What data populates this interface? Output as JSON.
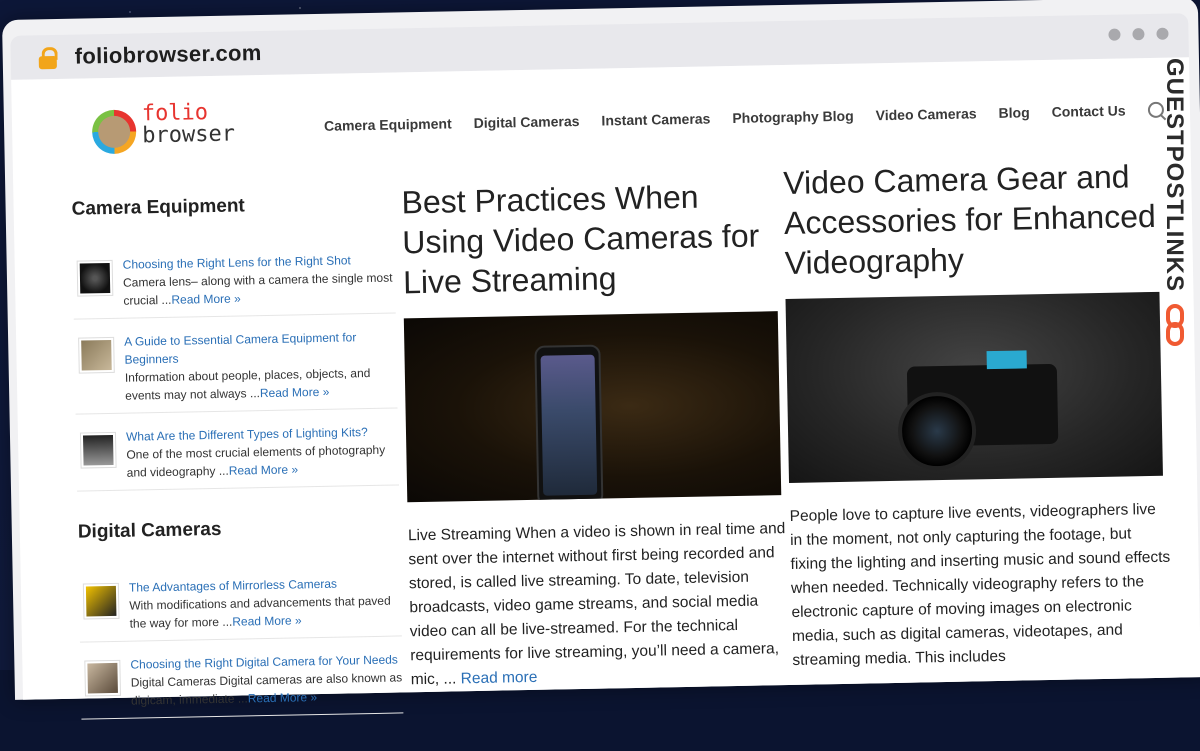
{
  "browser": {
    "url": "foliobrowser.com"
  },
  "logo": {
    "line1": "folio",
    "line2": "browser"
  },
  "nav": {
    "items": [
      "Camera Equipment",
      "Digital Cameras",
      "Instant Cameras",
      "Photography Blog",
      "Video Cameras",
      "Blog",
      "Contact Us"
    ]
  },
  "sidebar": {
    "widgets": [
      {
        "title": "Camera Equipment",
        "posts": [
          {
            "title": "Choosing the Right Lens for the Right Shot",
            "excerpt": "Camera lens– along with a camera the single most crucial ...",
            "more": "Read More »"
          },
          {
            "title": "A Guide to Essential Camera Equipment for Beginners",
            "excerpt": "Information about people, places, objects, and events may not always ...",
            "more": "Read More »"
          },
          {
            "title": "What Are the Different Types of Lighting Kits?",
            "excerpt": "One of the most crucial elements of photography and videography ...",
            "more": "Read More »"
          }
        ]
      },
      {
        "title": "Digital Cameras",
        "posts": [
          {
            "title": "The Advantages of Mirrorless Cameras",
            "excerpt": "With modifications and advancements that paved the way for more ...",
            "more": "Read More »"
          },
          {
            "title": "Choosing the Right Digital Camera for Your Needs",
            "excerpt": "Digital Cameras Digital cameras are also known as digicam, immediate ...",
            "more": "Read More »"
          }
        ]
      }
    ]
  },
  "articles": [
    {
      "title": "Best Practices When Using Video Cameras for Live Streaming",
      "excerpt": "Live Streaming When a video is shown in real time and sent over the internet without first being recorded and stored, is called live streaming.  To date, television broadcasts, video game streams, and social media video can all be live-streamed. For the technical requirements for live streaming, you’ll need a camera, mic, ...",
      "more": "Read more"
    },
    {
      "title": "Video Camera Gear and Accessories for Enhanced Videography",
      "excerpt": "People love to capture live events, videographers live in the moment, not only capturing the footage, but fixing the lighting and inserting music and sound effects when needed. Technically videography refers to the electronic capture of moving images on electronic media, such as digital cameras, videotapes, and streaming media. This includes"
    }
  ],
  "badge": {
    "text": "GUESTPOSTLINKS"
  }
}
